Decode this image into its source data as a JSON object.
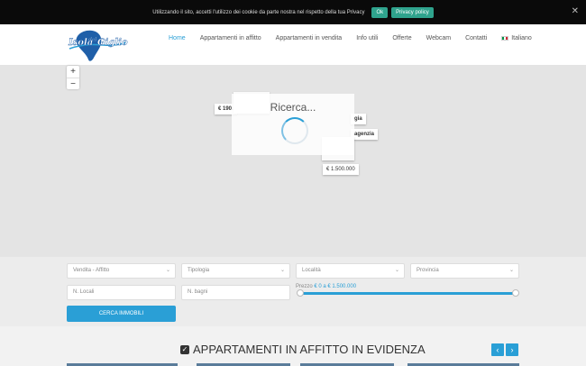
{
  "cookie": {
    "text": "Utilizzando il sito, accetti l'utilizzo dei cookie da parte nostra nel rispetto della tua Privacy",
    "ok_label": "Ok",
    "privacy_label": "Privacy policy",
    "close_glyph": "✕"
  },
  "header": {
    "logo_text": "Isola del Giglio",
    "nav": [
      {
        "label": "Home",
        "active": true
      },
      {
        "label": "Appartamenti in affitto"
      },
      {
        "label": "Appartamenti in vendita"
      },
      {
        "label": "Info utili"
      },
      {
        "label": "Offerte"
      },
      {
        "label": "Webcam"
      },
      {
        "label": "Contatti"
      },
      {
        "label": "Italiano",
        "icon": "italy-flag-icon"
      }
    ]
  },
  "map": {
    "zoom_in": "+",
    "zoom_out": "−",
    "loading_text": "Ricerca...",
    "price_tags": [
      {
        "label": "€ 190.",
        "bold": true
      },
      {
        "label": "€ 1.500.000"
      },
      {
        "label": "gia",
        "bold": true
      },
      {
        "label": "agenzia",
        "bold": true
      }
    ]
  },
  "search": {
    "fields": [
      {
        "label": "Vendita - Affitto",
        "dropdown": true
      },
      {
        "label": "Tipologia",
        "dropdown": true
      },
      {
        "label": "Località",
        "dropdown": true
      },
      {
        "label": "Provincia",
        "dropdown": true
      },
      {
        "label": "N. Locali"
      },
      {
        "label": "N. bagni"
      }
    ],
    "price_prefix": "Prezzo",
    "price_range": "€ 0 a € 1.500.000",
    "price_min": 0,
    "price_max": 1500000,
    "submit_label": "Cerca immobili"
  },
  "featured": {
    "title": "Appartamenti in affitto in evidenza",
    "prev_glyph": "‹",
    "next_glyph": "›"
  },
  "colors": {
    "accent": "#2a9fd6",
    "cookie_button": "#2fa38d"
  }
}
